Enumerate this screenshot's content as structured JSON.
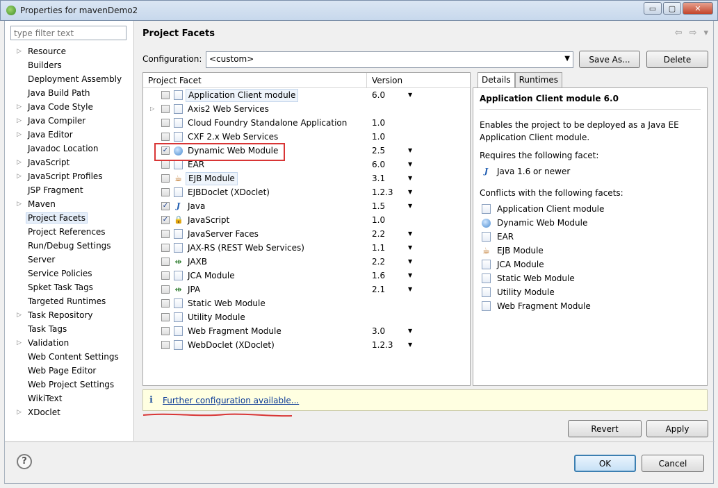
{
  "window": {
    "title": "Properties for mavenDemo2",
    "min": "▭",
    "max": "▢",
    "close": "✕"
  },
  "filter": {
    "placeholder": "type filter text"
  },
  "nav": {
    "items": [
      {
        "label": "Resource",
        "expandable": true
      },
      {
        "label": "Builders",
        "expandable": false
      },
      {
        "label": "Deployment Assembly",
        "expandable": false
      },
      {
        "label": "Java Build Path",
        "expandable": false
      },
      {
        "label": "Java Code Style",
        "expandable": true
      },
      {
        "label": "Java Compiler",
        "expandable": true
      },
      {
        "label": "Java Editor",
        "expandable": true
      },
      {
        "label": "Javadoc Location",
        "expandable": false
      },
      {
        "label": "JavaScript",
        "expandable": true
      },
      {
        "label": "JavaScript Profiles",
        "expandable": true
      },
      {
        "label": "JSP Fragment",
        "expandable": false
      },
      {
        "label": "Maven",
        "expandable": true
      },
      {
        "label": "Project Facets",
        "expandable": false,
        "selected": true
      },
      {
        "label": "Project References",
        "expandable": false
      },
      {
        "label": "Run/Debug Settings",
        "expandable": false
      },
      {
        "label": "Server",
        "expandable": false
      },
      {
        "label": "Service Policies",
        "expandable": false
      },
      {
        "label": "Spket Task Tags",
        "expandable": false
      },
      {
        "label": "Targeted Runtimes",
        "expandable": false
      },
      {
        "label": "Task Repository",
        "expandable": true
      },
      {
        "label": "Task Tags",
        "expandable": false
      },
      {
        "label": "Validation",
        "expandable": true
      },
      {
        "label": "Web Content Settings",
        "expandable": false
      },
      {
        "label": "Web Page Editor",
        "expandable": false
      },
      {
        "label": "Web Project Settings",
        "expandable": false
      },
      {
        "label": "WikiText",
        "expandable": false
      },
      {
        "label": "XDoclet",
        "expandable": true
      }
    ]
  },
  "main": {
    "title": "Project Facets",
    "nav_back": "⇦",
    "nav_fwd": "⇨",
    "menu": "▾",
    "config_label": "Configuration:",
    "config_value": "<custom>",
    "save_as": "Save As...",
    "delete": "Delete",
    "col_facet": "Project Facet",
    "col_version": "Version"
  },
  "facets": [
    {
      "name": "Application Client module",
      "version": "6.0",
      "checked": false,
      "icon": "page",
      "dd": true,
      "highlight": true,
      "expander": false
    },
    {
      "name": "Axis2 Web Services",
      "version": "",
      "checked": false,
      "icon": "page",
      "dd": false,
      "expander": true
    },
    {
      "name": "Cloud Foundry Standalone Application",
      "version": "1.0",
      "checked": false,
      "icon": "page",
      "dd": false
    },
    {
      "name": "CXF 2.x Web Services",
      "version": "1.0",
      "checked": false,
      "icon": "page",
      "dd": false
    },
    {
      "name": "Dynamic Web Module",
      "version": "2.5",
      "checked": true,
      "icon": "globe",
      "dd": true
    },
    {
      "name": "EAR",
      "version": "6.0",
      "checked": false,
      "icon": "page",
      "dd": true
    },
    {
      "name": "EJB Module",
      "version": "3.1",
      "checked": false,
      "icon": "bean",
      "dd": true,
      "highlight": true
    },
    {
      "name": "EJBDoclet (XDoclet)",
      "version": "1.2.3",
      "checked": false,
      "icon": "page",
      "dd": true
    },
    {
      "name": "Java",
      "version": "1.5",
      "checked": true,
      "icon": "java",
      "dd": true
    },
    {
      "name": "JavaScript",
      "version": "1.0",
      "checked": true,
      "icon": "jslock",
      "dd": false
    },
    {
      "name": "JavaServer Faces",
      "version": "2.2",
      "checked": false,
      "icon": "page",
      "dd": true
    },
    {
      "name": "JAX-RS (REST Web Services)",
      "version": "1.1",
      "checked": false,
      "icon": "page",
      "dd": true
    },
    {
      "name": "JAXB",
      "version": "2.2",
      "checked": false,
      "icon": "dia",
      "dd": true
    },
    {
      "name": "JCA Module",
      "version": "1.6",
      "checked": false,
      "icon": "page",
      "dd": true
    },
    {
      "name": "JPA",
      "version": "2.1",
      "checked": false,
      "icon": "dia",
      "dd": true
    },
    {
      "name": "Static Web Module",
      "version": "",
      "checked": false,
      "icon": "page",
      "dd": false
    },
    {
      "name": "Utility Module",
      "version": "",
      "checked": false,
      "icon": "page",
      "dd": false
    },
    {
      "name": "Web Fragment Module",
      "version": "3.0",
      "checked": false,
      "icon": "page",
      "dd": true
    },
    {
      "name": "WebDoclet (XDoclet)",
      "version": "1.2.3",
      "checked": false,
      "icon": "page",
      "dd": true
    }
  ],
  "details": {
    "tab_details": "Details",
    "tab_runtimes": "Runtimes",
    "title": "Application Client module 6.0",
    "description": "Enables the project to be deployed as a Java EE Application Client module.",
    "requires_label": "Requires the following facet:",
    "requires": [
      {
        "name": "Java 1.6 or newer",
        "icon": "java"
      }
    ],
    "conflicts_label": "Conflicts with the following facets:",
    "conflicts": [
      {
        "name": "Application Client module",
        "icon": "page"
      },
      {
        "name": "Dynamic Web Module",
        "icon": "globe"
      },
      {
        "name": "EAR",
        "icon": "page"
      },
      {
        "name": "EJB Module",
        "icon": "bean"
      },
      {
        "name": "JCA Module",
        "icon": "page"
      },
      {
        "name": "Static Web Module",
        "icon": "page"
      },
      {
        "name": "Utility Module",
        "icon": "page"
      },
      {
        "name": "Web Fragment Module",
        "icon": "page"
      }
    ]
  },
  "infobar": {
    "icon": "i",
    "link": "Further configuration available..."
  },
  "buttons": {
    "revert": "Revert",
    "apply": "Apply",
    "ok": "OK",
    "cancel": "Cancel"
  },
  "help": "?",
  "icons": {
    "page": "",
    "globe": "",
    "bean": "☕",
    "java": "J",
    "jslock": "🔒",
    "dia": "⇹",
    "expander": "▷",
    "check": "✓",
    "dropdown": "▼"
  },
  "colors": {
    "accent": "#3c7fb1",
    "highlight_box": "#d83535",
    "link": "#0b3a96",
    "info_bg": "#ffffe1"
  }
}
